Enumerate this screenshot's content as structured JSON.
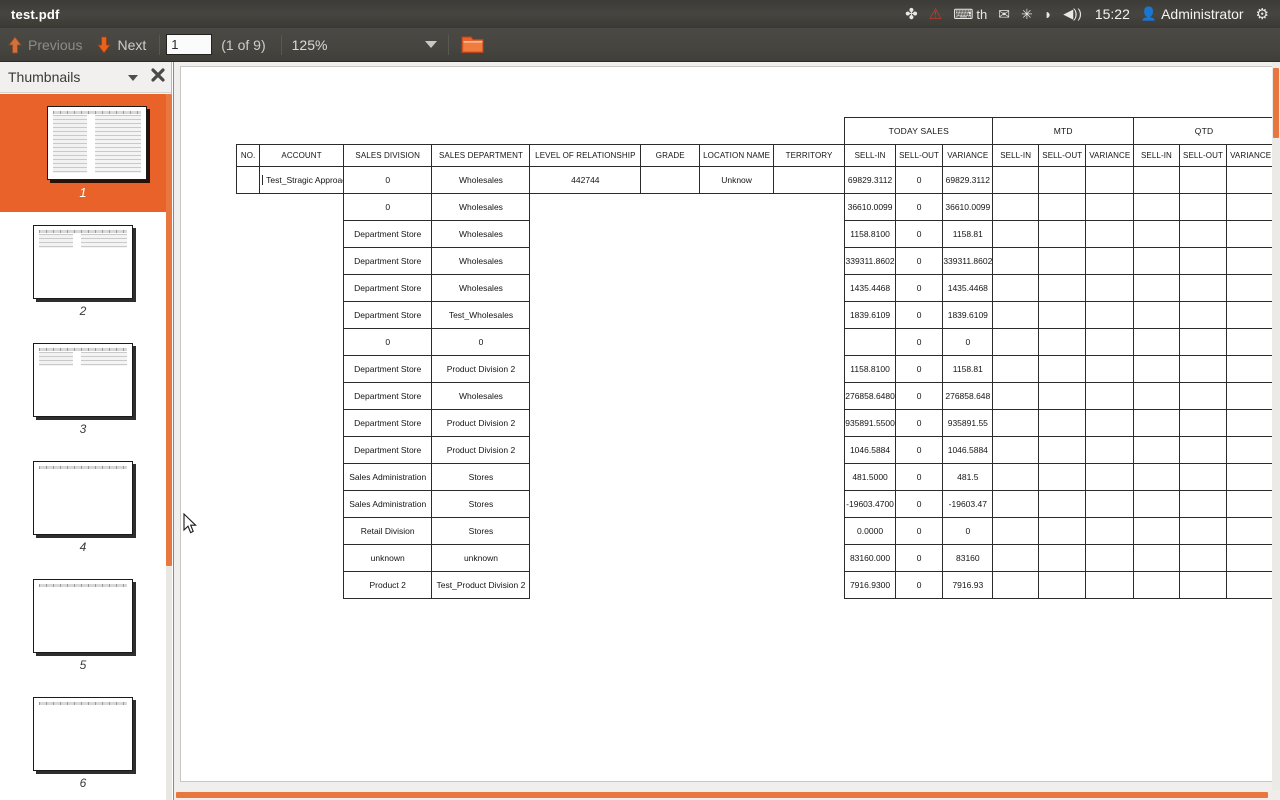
{
  "window": {
    "title": "test.pdf"
  },
  "tray": {
    "icons": [
      {
        "name": "dropbox-icon",
        "glyph": "✤"
      },
      {
        "name": "warning-icon",
        "glyph": "⚠"
      },
      {
        "name": "keyboard-indicator-icon",
        "glyph": "⌨"
      },
      {
        "name": "keyboard-layout-label",
        "glyph": "th"
      },
      {
        "name": "mail-icon",
        "glyph": "✉"
      },
      {
        "name": "bluetooth-icon",
        "glyph": "✸"
      },
      {
        "name": "wifi-icon",
        "glyph": "◗"
      },
      {
        "name": "volume-icon",
        "glyph": "🔊"
      }
    ],
    "clock": "15:22",
    "user": "Administrator",
    "user_icon": "👤",
    "session_icon": "⚙"
  },
  "toolbar": {
    "previous_label": "Previous",
    "next_label": "Next",
    "page_number_value": "1",
    "page_number_placeholder": "1",
    "page_count_label": "(1 of 9)",
    "zoom_value": "125%",
    "open_folder_icon": "folder-icon"
  },
  "sidebar": {
    "title": "Thumbnails",
    "collapse_icon": "chevron-down-icon",
    "close_icon": "close-icon",
    "thumbnails": [
      {
        "label": "1",
        "selected": true,
        "style": "full"
      },
      {
        "label": "2",
        "selected": false,
        "style": "short"
      },
      {
        "label": "3",
        "selected": false,
        "style": "short"
      },
      {
        "label": "4",
        "selected": false,
        "style": "header-only"
      },
      {
        "label": "5",
        "selected": false,
        "style": "header-only"
      },
      {
        "label": "6",
        "selected": false,
        "style": "header-only"
      }
    ]
  },
  "colors": {
    "accent_orange": "#e8622a",
    "scrollbar_orange": "#e8763f",
    "panel_dark": "#46453f",
    "page_white": "#ffffff"
  },
  "report": {
    "group_headers": [
      {
        "label": "TODAY SALES",
        "span": 3
      },
      {
        "label": "MTD",
        "span": 3
      },
      {
        "label": "QTD",
        "span": 3
      }
    ],
    "columns": [
      "NO.",
      "ACCOUNT",
      "SALES DIVISION",
      "SALES DEPARTMENT",
      "LEVEL OF RELATIONSHIP",
      "GRADE",
      "LOCATION NAME",
      "TERRITORY",
      "SELL-IN",
      "SELL-OUT",
      "VARIANCE",
      "SELL-IN",
      "SELL-OUT",
      "VARIANCE",
      "SELL-IN",
      "SELL-OUT",
      "VARIANCE"
    ],
    "rows": [
      {
        "no": "",
        "account": "Test_Stragic Approach Co.",
        "division": "0",
        "department": "Wholesales",
        "relationship": "442744",
        "grade": "",
        "location": "Unknow",
        "territory": "",
        "today_sellin": "69829.3112",
        "today_sellout": "0",
        "today_variance": "69829.3112",
        "mtd_sellin": "",
        "mtd_sellout": "",
        "mtd_variance": "",
        "qtd_sellin": "",
        "qtd_sellout": "",
        "qtd_variance": ""
      },
      {
        "no": "",
        "account": "",
        "division": "0",
        "department": "Wholesales",
        "relationship": "",
        "grade": "",
        "location": "",
        "territory": "",
        "today_sellin": "36610.0099",
        "today_sellout": "0",
        "today_variance": "36610.0099",
        "mtd_sellin": "",
        "mtd_sellout": "",
        "mtd_variance": "",
        "qtd_sellin": "",
        "qtd_sellout": "",
        "qtd_variance": ""
      },
      {
        "no": "",
        "account": "",
        "division": "Department Store",
        "department": "Wholesales",
        "relationship": "",
        "grade": "",
        "location": "",
        "territory": "",
        "today_sellin": "1158.8100",
        "today_sellout": "0",
        "today_variance": "1158.81",
        "mtd_sellin": "",
        "mtd_sellout": "",
        "mtd_variance": "",
        "qtd_sellin": "",
        "qtd_sellout": "",
        "qtd_variance": ""
      },
      {
        "no": "",
        "account": "",
        "division": "Department Store",
        "department": "Wholesales",
        "relationship": "",
        "grade": "",
        "location": "",
        "territory": "",
        "today_sellin": "339311.8602",
        "today_sellout": "0",
        "today_variance": "339311.8602",
        "mtd_sellin": "",
        "mtd_sellout": "",
        "mtd_variance": "",
        "qtd_sellin": "",
        "qtd_sellout": "",
        "qtd_variance": ""
      },
      {
        "no": "",
        "account": "",
        "division": "Department Store",
        "department": "Wholesales",
        "relationship": "",
        "grade": "",
        "location": "",
        "territory": "",
        "today_sellin": "1435.4468",
        "today_sellout": "0",
        "today_variance": "1435.4468",
        "mtd_sellin": "",
        "mtd_sellout": "",
        "mtd_variance": "",
        "qtd_sellin": "",
        "qtd_sellout": "",
        "qtd_variance": ""
      },
      {
        "no": "",
        "account": "",
        "division": "Department Store",
        "department": "Test_Wholesales",
        "relationship": "",
        "grade": "",
        "location": "",
        "territory": "",
        "today_sellin": "1839.6109",
        "today_sellout": "0",
        "today_variance": "1839.6109",
        "mtd_sellin": "",
        "mtd_sellout": "",
        "mtd_variance": "",
        "qtd_sellin": "",
        "qtd_sellout": "",
        "qtd_variance": ""
      },
      {
        "no": "",
        "account": "",
        "division": "0",
        "department": "0",
        "relationship": "",
        "grade": "",
        "location": "",
        "territory": "",
        "today_sellin": "",
        "today_sellout": "0",
        "today_variance": "0",
        "mtd_sellin": "",
        "mtd_sellout": "",
        "mtd_variance": "",
        "qtd_sellin": "",
        "qtd_sellout": "",
        "qtd_variance": ""
      },
      {
        "no": "",
        "account": "",
        "division": "Department Store",
        "department": "Product Division 2",
        "relationship": "",
        "grade": "",
        "location": "",
        "territory": "",
        "today_sellin": "1158.8100",
        "today_sellout": "0",
        "today_variance": "1158.81",
        "mtd_sellin": "",
        "mtd_sellout": "",
        "mtd_variance": "",
        "qtd_sellin": "",
        "qtd_sellout": "",
        "qtd_variance": ""
      },
      {
        "no": "",
        "account": "",
        "division": "Department Store",
        "department": "Wholesales",
        "relationship": "",
        "grade": "",
        "location": "",
        "territory": "",
        "today_sellin": "276858.6480",
        "today_sellout": "0",
        "today_variance": "276858.648",
        "mtd_sellin": "",
        "mtd_sellout": "",
        "mtd_variance": "",
        "qtd_sellin": "",
        "qtd_sellout": "",
        "qtd_variance": ""
      },
      {
        "no": "",
        "account": "",
        "division": "Department Store",
        "department": "Product Division 2",
        "relationship": "",
        "grade": "",
        "location": "",
        "territory": "",
        "today_sellin": "935891.5500",
        "today_sellout": "0",
        "today_variance": "935891.55",
        "mtd_sellin": "",
        "mtd_sellout": "",
        "mtd_variance": "",
        "qtd_sellin": "",
        "qtd_sellout": "",
        "qtd_variance": ""
      },
      {
        "no": "",
        "account": "",
        "division": "Department Store",
        "department": "Product Division 2",
        "relationship": "",
        "grade": "",
        "location": "",
        "territory": "",
        "today_sellin": "1046.5884",
        "today_sellout": "0",
        "today_variance": "1046.5884",
        "mtd_sellin": "",
        "mtd_sellout": "",
        "mtd_variance": "",
        "qtd_sellin": "",
        "qtd_sellout": "",
        "qtd_variance": ""
      },
      {
        "no": "",
        "account": "",
        "division": "Sales Administration",
        "department": "Stores",
        "relationship": "",
        "grade": "",
        "location": "",
        "territory": "",
        "today_sellin": "481.5000",
        "today_sellout": "0",
        "today_variance": "481.5",
        "mtd_sellin": "",
        "mtd_sellout": "",
        "mtd_variance": "",
        "qtd_sellin": "",
        "qtd_sellout": "",
        "qtd_variance": ""
      },
      {
        "no": "",
        "account": "",
        "division": "Sales Administration",
        "department": "Stores",
        "relationship": "",
        "grade": "",
        "location": "",
        "territory": "",
        "today_sellin": "-19603.4700",
        "today_sellout": "0",
        "today_variance": "-19603.47",
        "mtd_sellin": "",
        "mtd_sellout": "",
        "mtd_variance": "",
        "qtd_sellin": "",
        "qtd_sellout": "",
        "qtd_variance": ""
      },
      {
        "no": "",
        "account": "",
        "division": "Retail Division",
        "department": "Stores",
        "relationship": "",
        "grade": "",
        "location": "",
        "territory": "",
        "today_sellin": "0.0000",
        "today_sellout": "0",
        "today_variance": "0",
        "mtd_sellin": "",
        "mtd_sellout": "",
        "mtd_variance": "",
        "qtd_sellin": "",
        "qtd_sellout": "",
        "qtd_variance": ""
      },
      {
        "no": "",
        "account": "",
        "division": "unknown",
        "department": "unknown",
        "relationship": "",
        "grade": "",
        "location": "",
        "territory": "",
        "today_sellin": "83160.000",
        "today_sellout": "0",
        "today_variance": "83160",
        "mtd_sellin": "",
        "mtd_sellout": "",
        "mtd_variance": "",
        "qtd_sellin": "",
        "qtd_sellout": "",
        "qtd_variance": ""
      },
      {
        "no": "",
        "account": "",
        "division": "Product 2",
        "department": "Test_Product Division 2",
        "relationship": "",
        "grade": "",
        "location": "",
        "territory": "",
        "today_sellin": "7916.9300",
        "today_sellout": "0",
        "today_variance": "7916.93",
        "mtd_sellin": "",
        "mtd_sellout": "",
        "mtd_variance": "",
        "qtd_sellin": "",
        "qtd_sellout": "",
        "qtd_variance": ""
      }
    ]
  }
}
